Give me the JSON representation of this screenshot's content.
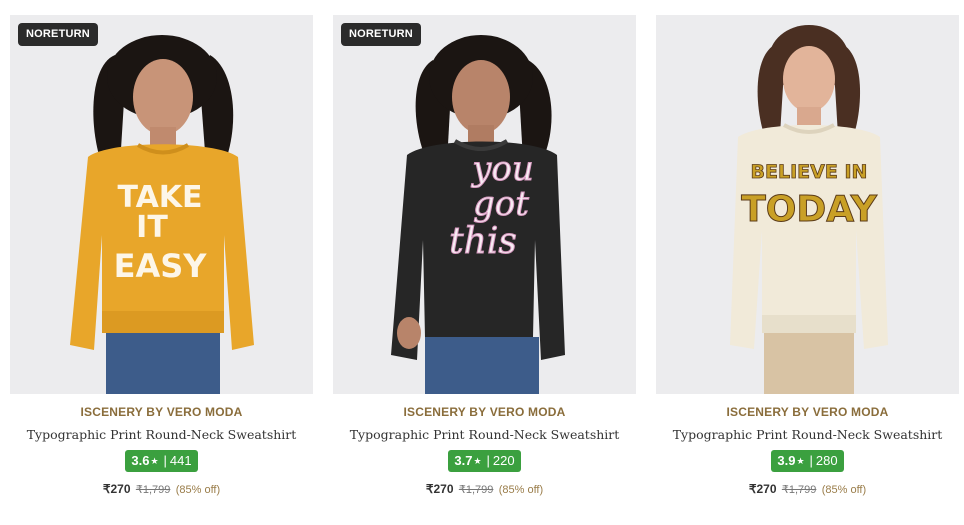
{
  "products": [
    {
      "badge": "NORETURN",
      "brand": "ISCENERY BY VERO MODA",
      "name": "Typographic Print Round-Neck Sweatshirt",
      "rating": "3.6",
      "reviews": "441",
      "price": "₹270",
      "mrp": "₹1,799",
      "discount": "(85% off)",
      "print_text": [
        "TAKE",
        "IT",
        "EASY"
      ],
      "sweatshirt_color": "#e8a62a"
    },
    {
      "badge": "NORETURN",
      "brand": "ISCENERY BY VERO MODA",
      "name": "Typographic Print Round-Neck Sweatshirt",
      "rating": "3.7",
      "reviews": "220",
      "price": "₹270",
      "mrp": "₹1,799",
      "discount": "(85% off)",
      "print_text": [
        "you",
        "got",
        "this"
      ],
      "sweatshirt_color": "#262626"
    },
    {
      "brand": "ISCENERY BY VERO MODA",
      "name": "Typographic Print Round-Neck Sweatshirt",
      "rating": "3.9",
      "reviews": "280",
      "price": "₹270",
      "mrp": "₹1,799",
      "discount": "(85% off)",
      "print_text": [
        "BELIEVE IN",
        "TODAY"
      ],
      "sweatshirt_color": "#f1ead9"
    }
  ],
  "colors": {
    "rating_bg": "#3ba03f",
    "brand_text": "#8a6d3b",
    "badge_bg": "#2b2b2b",
    "photo_bg": "#ececee"
  }
}
